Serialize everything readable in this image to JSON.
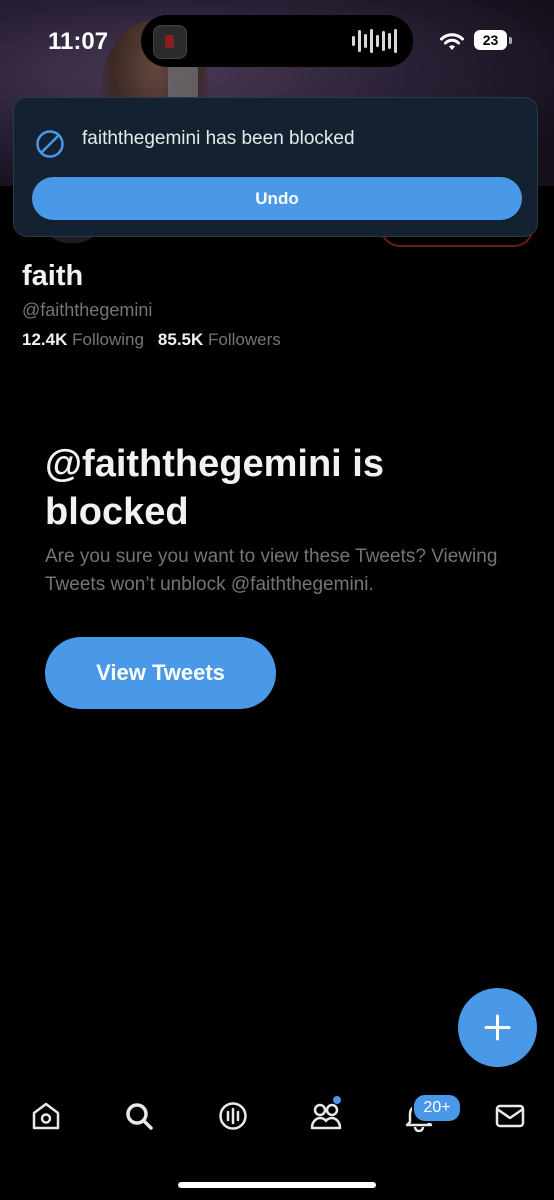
{
  "status_bar": {
    "time": "11:07",
    "battery": "23"
  },
  "toast": {
    "message": "faiththegemini has been blocked",
    "undo_label": "Undo"
  },
  "profile": {
    "name": "faith",
    "handle": "@faiththegemini",
    "following_count": "12.4K",
    "following_label": "Following",
    "followers_count": "85.5K",
    "followers_label": "Followers"
  },
  "blocked": {
    "title": "@faiththegemini is blocked",
    "description": "Are you sure you want to view these Tweets? Viewing Tweets won’t unblock @faiththegemini.",
    "view_button_label": "View Tweets"
  },
  "nav": {
    "items": [
      {
        "icon": "home-icon"
      },
      {
        "icon": "search-icon"
      },
      {
        "icon": "spaces-icon"
      },
      {
        "icon": "communities-icon"
      },
      {
        "icon": "notifications-icon"
      },
      {
        "icon": "messages-icon"
      }
    ],
    "notification_badge": "20+"
  },
  "colors": {
    "accent": "#4a99e9",
    "background": "#000000",
    "muted_text": "#71767b",
    "toast_bg": "#132130"
  }
}
